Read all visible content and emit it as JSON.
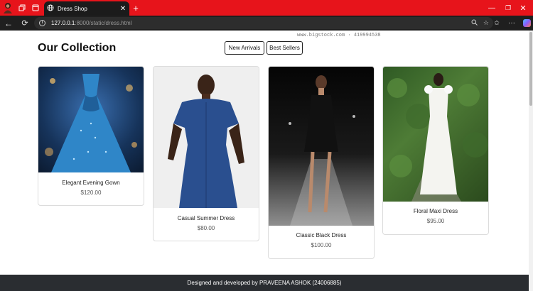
{
  "browser": {
    "tab_title": "Dress Shop",
    "url_host": "127.0.0.1",
    "url_rest": ":8000/static/dress.html"
  },
  "page": {
    "heading": "Our Collection",
    "watermark": "www.bigstock.com · 419994538",
    "filters": [
      "New Arrivals",
      "Best Sellers"
    ],
    "products": [
      {
        "name": "Elegant Evening Gown",
        "price": "$120.00"
      },
      {
        "name": "Casual Summer Dress",
        "price": "$80.00"
      },
      {
        "name": "Classic Black Dress",
        "price": "$100.00"
      },
      {
        "name": "Floral Maxi Dress",
        "price": "$95.00"
      }
    ],
    "footer": "Designed and developed by PRAVEENA ASHOK (24006885)"
  },
  "icons": {
    "avatar": "avatar",
    "workspaces": "workspaces-icon",
    "tab_actions": "tab-actions-icon",
    "site": "globe-icon",
    "close_tab": "close-icon",
    "new_tab": "plus-icon",
    "back": "back-arrow-icon",
    "reload": "reload-icon",
    "info": "info-icon",
    "zoom": "zoom-icon",
    "favorite": "star-icon",
    "favorites_bar": "favorites-icon",
    "more": "more-icon",
    "copilot": "copilot-icon"
  },
  "colors": {
    "tabbar": "#e7141b",
    "toolbar": "#1f1f1f",
    "footer": "#2a2d31"
  }
}
